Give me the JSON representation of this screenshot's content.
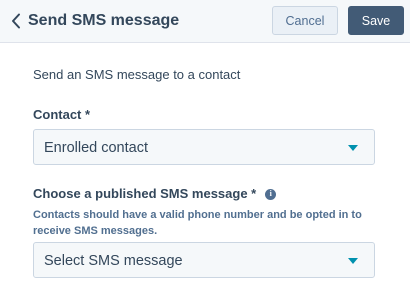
{
  "header": {
    "title": "Send SMS message",
    "back_icon": "chevron-left-icon",
    "cancel_label": "Cancel",
    "save_label": "Save"
  },
  "description": "Send an SMS message to a contact",
  "contact_field": {
    "label": "Contact *",
    "selected": "Enrolled contact"
  },
  "sms_field": {
    "label": "Choose a published SMS message *",
    "info_icon": "info-icon",
    "help_text": "Contacts should have a valid phone number and be opted in to receive SMS messages.",
    "selected": "Select SMS message"
  },
  "colors": {
    "header_bg": "#f5f8fa",
    "primary_button": "#425b76",
    "caret": "#0091ae",
    "text": "#33475b"
  }
}
